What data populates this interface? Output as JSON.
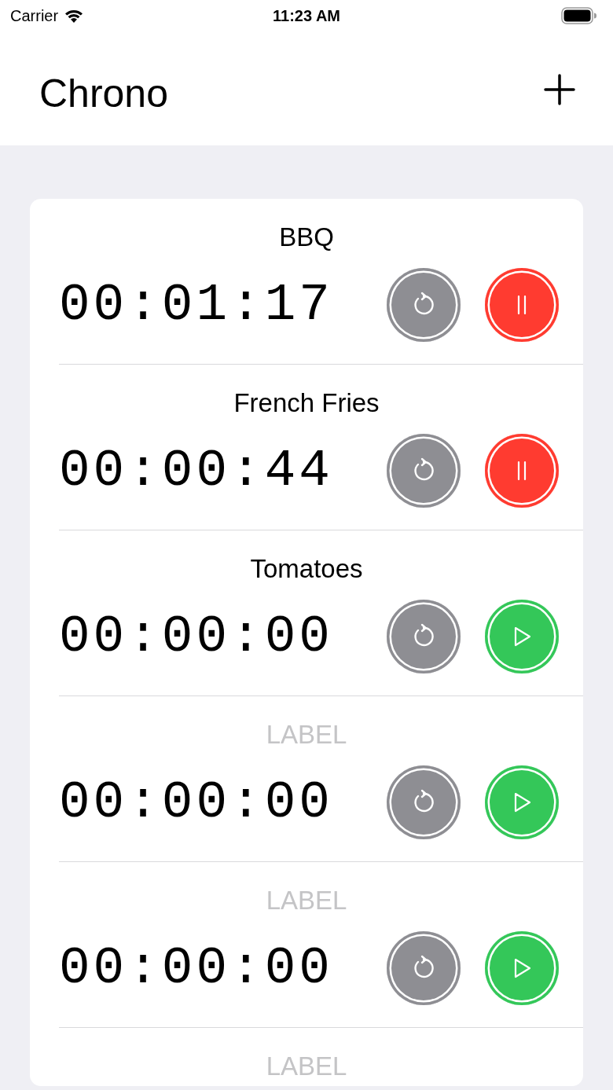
{
  "status_bar": {
    "carrier": "Carrier",
    "time": "11:23 AM"
  },
  "nav": {
    "title": "Chrono"
  },
  "timers": [
    {
      "label": "BBQ",
      "time": "00:01:17",
      "running": true
    },
    {
      "label": "French Fries",
      "time": "00:00:44",
      "running": true
    },
    {
      "label": "Tomatoes",
      "time": "00:00:00",
      "running": false
    },
    {
      "placeholder": "LABEL",
      "time": "00:00:00",
      "running": false
    },
    {
      "placeholder": "LABEL",
      "time": "00:00:00",
      "running": false
    },
    {
      "placeholder": "LABEL"
    }
  ]
}
